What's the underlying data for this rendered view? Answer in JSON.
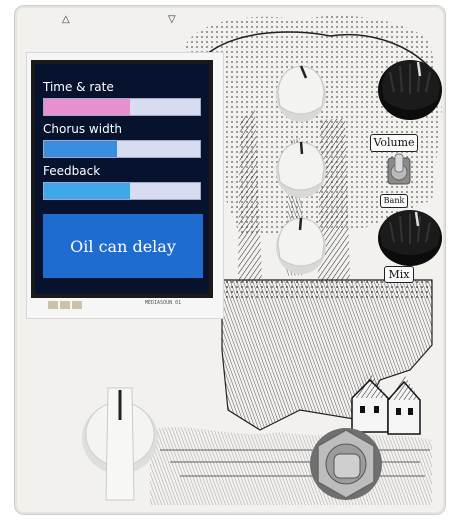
{
  "screen": {
    "params": [
      {
        "label": "Time & rate",
        "fill_percent": 55,
        "color": "#e88fcf"
      },
      {
        "label": "Chorus width",
        "fill_percent": 47,
        "color": "#3a8ee0"
      },
      {
        "label": "Feedback",
        "fill_percent": 55,
        "color": "#3ea8e8"
      }
    ],
    "preset_name": "Oil can delay",
    "footer_text": "MEDIASOUN 01"
  },
  "labels": {
    "volume": "Volume",
    "bank": "Bank",
    "mix": "Mix"
  },
  "colors": {
    "enclosure": "#f2f1ee",
    "screen_bg": "#06122e",
    "preset_bg": "#1e6cd0",
    "knob_white": "#f3f3f1",
    "knob_black": "#141414"
  }
}
